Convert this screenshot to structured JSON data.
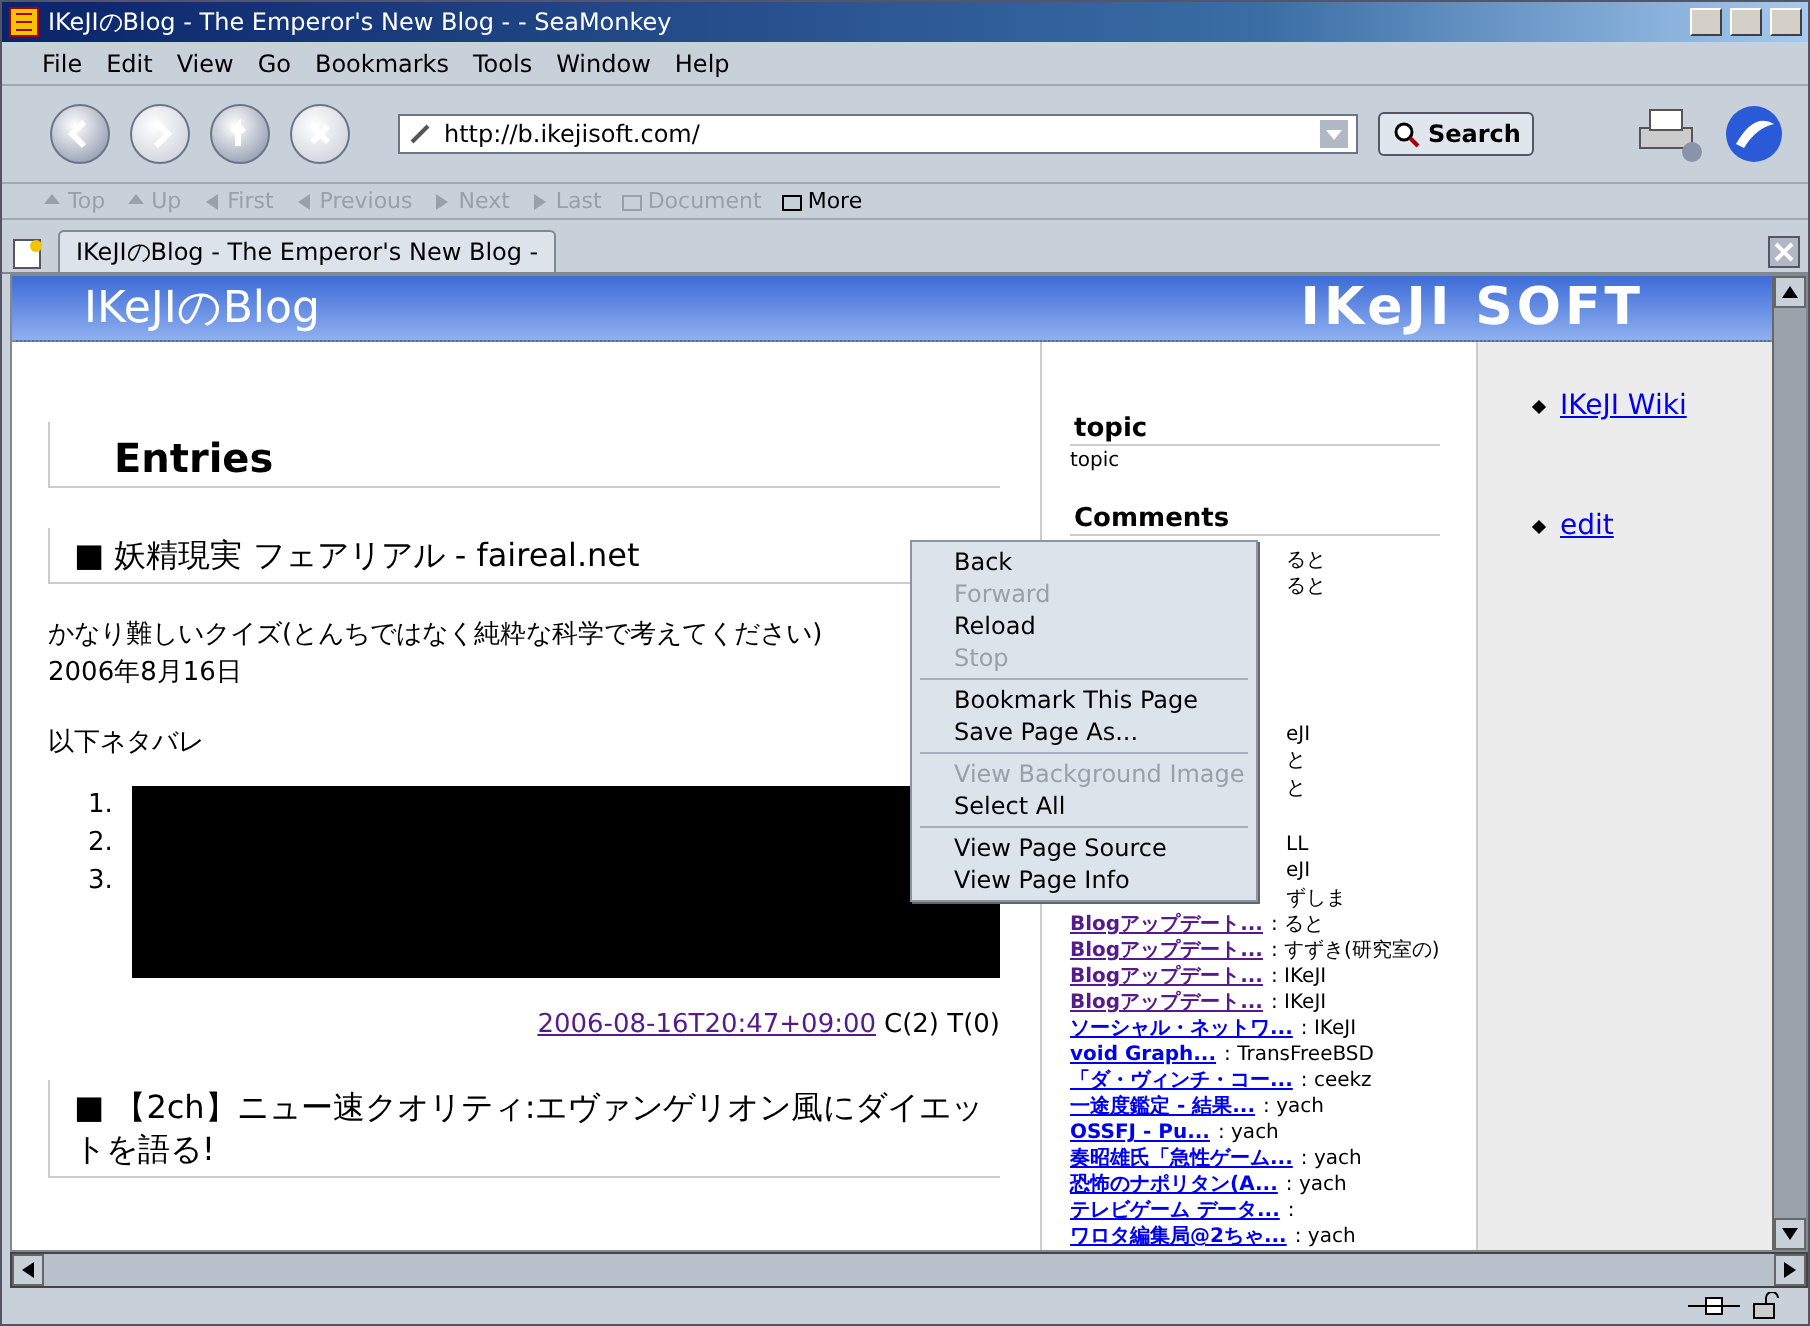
{
  "window": {
    "title": "IKeJIのBlog - The Emperor's New Blog - - SeaMonkey"
  },
  "menu_bar": [
    "File",
    "Edit",
    "View",
    "Go",
    "Bookmarks",
    "Tools",
    "Window",
    "Help"
  ],
  "navigation": {
    "buttons": [
      {
        "kind": "back",
        "disabled": false
      },
      {
        "kind": "forward",
        "disabled": true
      },
      {
        "kind": "reload",
        "disabled": false
      },
      {
        "kind": "stop",
        "disabled": true
      }
    ],
    "url": "http://b.ikejisoft.com/",
    "search_button": "Search"
  },
  "link_toolbar": [
    {
      "label": "Top",
      "disabled": true,
      "kind": "up"
    },
    {
      "label": "Up",
      "disabled": true,
      "kind": "up"
    },
    {
      "label": "First",
      "disabled": true,
      "kind": "first"
    },
    {
      "label": "Previous",
      "disabled": true,
      "kind": "prev"
    },
    {
      "label": "Next",
      "disabled": true,
      "kind": "next"
    },
    {
      "label": "Last",
      "disabled": true,
      "kind": "last"
    },
    {
      "label": "Document",
      "disabled": true,
      "kind": "folder"
    },
    {
      "label": "More",
      "disabled": false,
      "kind": "folder"
    }
  ],
  "tabs": [
    {
      "label": "IKeJIのBlog - The Emperor's New Blog -",
      "selected": true
    }
  ],
  "page": {
    "site_title": "IKeJIのBlog",
    "site_logo": "IKeJI SOFT",
    "entries_heading": "Entries",
    "entry": {
      "title": "■ 妖精現実 フェアリアル - faireal.net",
      "body": "かなり難しいクイズ(とんちではなく純粋な科学で考えてください)",
      "date": "2006年8月16日",
      "spoiler": "以下ネタバレ",
      "list_numbers": [
        "1.",
        "2.",
        "3."
      ],
      "permalink": "2006-08-16T20:47+09:00",
      "counts": "C(2) T(0)"
    },
    "next_entry_title": "■ 【2ch】ニュー速クオリティ:エヴァンゲリオン風にダイエットを語る!",
    "topic_heading": "topic",
    "topic_text": "topic",
    "comments_heading": "Comments",
    "comments": [
      {
        "kind": "covered",
        "author": "ると"
      },
      {
        "kind": "covered",
        "author": "ると"
      },
      {
        "kind": "blank"
      },
      {
        "kind": "blank"
      },
      {
        "kind": "blank"
      },
      {
        "kind": "blank"
      },
      {
        "kind": "covered",
        "author": "eJI"
      },
      {
        "kind": "covered",
        "author": "と"
      },
      {
        "kind": "covered",
        "author": "と"
      },
      {
        "kind": "blank"
      },
      {
        "kind": "covered",
        "author": "LL"
      },
      {
        "kind": "covered",
        "author": "eJI"
      },
      {
        "kind": "covered",
        "author": "ずしま"
      },
      {
        "kind": "full",
        "link": "Blogアップデート...",
        "visited": true,
        "author": ": ると"
      },
      {
        "kind": "full",
        "link": "Blogアップデート...",
        "visited": true,
        "author": ": すずき(研究室の)"
      },
      {
        "kind": "full",
        "link": "Blogアップデート...",
        "visited": true,
        "author": ": IKeJI"
      },
      {
        "kind": "full",
        "link": "Blogアップデート...",
        "visited": true,
        "author": ": IKeJI"
      },
      {
        "kind": "full",
        "link": "ソーシャル・ネットワ...",
        "visited": false,
        "author": ": IKeJI"
      },
      {
        "kind": "full",
        "link": "void Graph...",
        "visited": false,
        "author": ": TransFreeBSD"
      },
      {
        "kind": "full",
        "link": "「ダ・ヴィンチ・コー...",
        "visited": false,
        "author": ": ceekz"
      },
      {
        "kind": "full",
        "link": "一途度鑑定 - 結果...",
        "visited": false,
        "author": ": yach"
      },
      {
        "kind": "full",
        "link": "OSSFJ - Pu...",
        "visited": false,
        "author": ": yach"
      },
      {
        "kind": "full",
        "link": "奏昭雄氏「急性ゲーム...",
        "visited": false,
        "author": ": yach"
      },
      {
        "kind": "full",
        "link": "恐怖のナポリタン(A...",
        "visited": false,
        "author": ": yach"
      },
      {
        "kind": "full",
        "link": "テレビゲーム データ...",
        "visited": false,
        "author": ":"
      },
      {
        "kind": "full",
        "link": "ワロタ編集局@2ちゃ...",
        "visited": false,
        "author": ": yach"
      }
    ],
    "side_links": [
      "IKeJI Wiki",
      "edit"
    ]
  },
  "context_menu": [
    {
      "label": "Back",
      "disabled": false,
      "separator_before": false
    },
    {
      "label": "Forward",
      "disabled": true,
      "separator_before": false
    },
    {
      "label": "Reload",
      "disabled": false,
      "separator_before": false
    },
    {
      "label": "Stop",
      "disabled": true,
      "separator_before": false
    },
    {
      "label": "Bookmark This Page",
      "disabled": false,
      "separator_before": true
    },
    {
      "label": "Save Page As...",
      "disabled": false,
      "separator_before": false
    },
    {
      "label": "View Background Image",
      "disabled": true,
      "separator_before": true
    },
    {
      "label": "Select All",
      "disabled": false,
      "separator_before": false
    },
    {
      "label": "View Page Source",
      "disabled": false,
      "separator_before": true
    },
    {
      "label": "View Page Info",
      "disabled": false,
      "separator_before": false
    }
  ]
}
